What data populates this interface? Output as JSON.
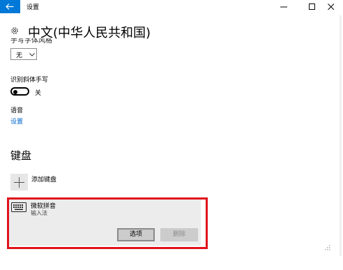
{
  "window": {
    "title": "设置"
  },
  "page": {
    "title": "中文(中华人民共和国)"
  },
  "clipped": {
    "label": "手写字体风格"
  },
  "handwriting_dropdown": {
    "value": "无"
  },
  "italic": {
    "label": "识别斜体手写",
    "toggle_state": "关"
  },
  "speech": {
    "label": "语音",
    "settings_link": "设置"
  },
  "keyboard": {
    "section_title": "键盘",
    "add_label": "添加键盘",
    "ime": {
      "name": "微软拼音",
      "type": "输入法"
    },
    "options_button": "选项",
    "delete_button": "删除"
  },
  "colors": {
    "accent": "#0078d7",
    "link": "#0066cc",
    "highlight": "#e0121b"
  }
}
